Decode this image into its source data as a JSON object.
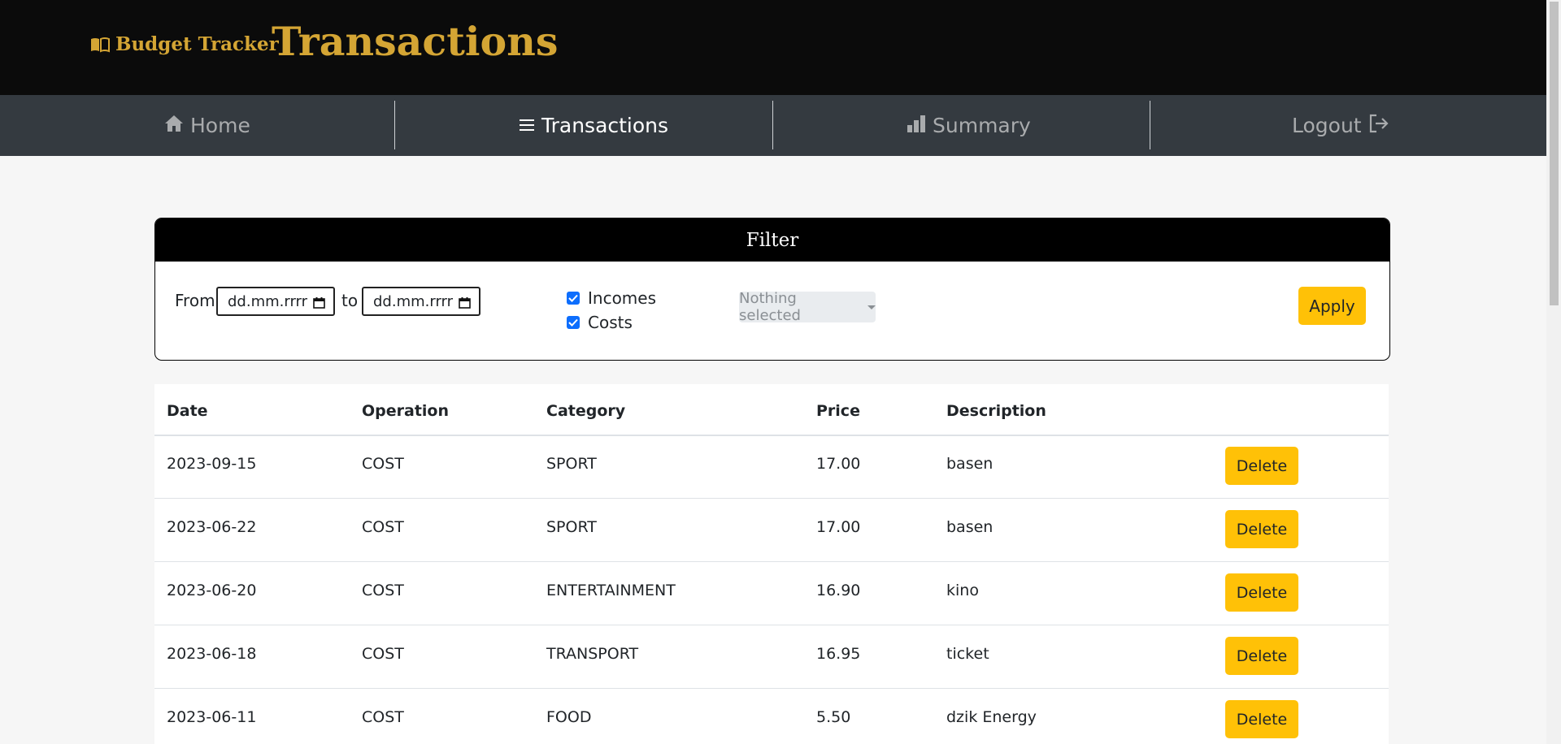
{
  "header": {
    "brand": "Budget Tracker",
    "brand_icon": "open-book-icon",
    "title": "Transactions"
  },
  "nav": {
    "items": [
      {
        "label": "Home",
        "icon": "home-icon",
        "active": false
      },
      {
        "label": "Transactions",
        "icon": "list-icon",
        "active": true
      },
      {
        "label": "Summary",
        "icon": "bar-chart-icon",
        "active": false
      },
      {
        "label": "Logout",
        "icon": "logout-icon",
        "active": false
      }
    ]
  },
  "filter": {
    "heading": "Filter",
    "from_label": "From",
    "to_label": "to",
    "from_value": "dd.mm.rrrr",
    "to_value": "dd.mm.rrrr",
    "incomes_label": "Incomes",
    "incomes_checked": true,
    "costs_label": "Costs",
    "costs_checked": true,
    "category_select": "Nothing selected",
    "apply_label": "Apply"
  },
  "table": {
    "columns": [
      "Date",
      "Operation",
      "Category",
      "Price",
      "Description"
    ],
    "delete_label": "Delete",
    "rows": [
      {
        "date": "2023-09-15",
        "operation": "COST",
        "category": "SPORT",
        "price": "17.00",
        "description": "basen"
      },
      {
        "date": "2023-06-22",
        "operation": "COST",
        "category": "SPORT",
        "price": "17.00",
        "description": "basen"
      },
      {
        "date": "2023-06-20",
        "operation": "COST",
        "category": "ENTERTAINMENT",
        "price": "16.90",
        "description": "kino"
      },
      {
        "date": "2023-06-18",
        "operation": "COST",
        "category": "TRANSPORT",
        "price": "16.95",
        "description": "ticket"
      },
      {
        "date": "2023-06-11",
        "operation": "COST",
        "category": "FOOD",
        "price": "5.50",
        "description": "dzik Energy"
      }
    ]
  },
  "colors": {
    "accent_gold": "#d4a534",
    "button_yellow": "#ffc107",
    "header_bg": "#0b0b0b",
    "nav_bg": "#343a40",
    "checkbox_blue": "#0d6efd"
  }
}
